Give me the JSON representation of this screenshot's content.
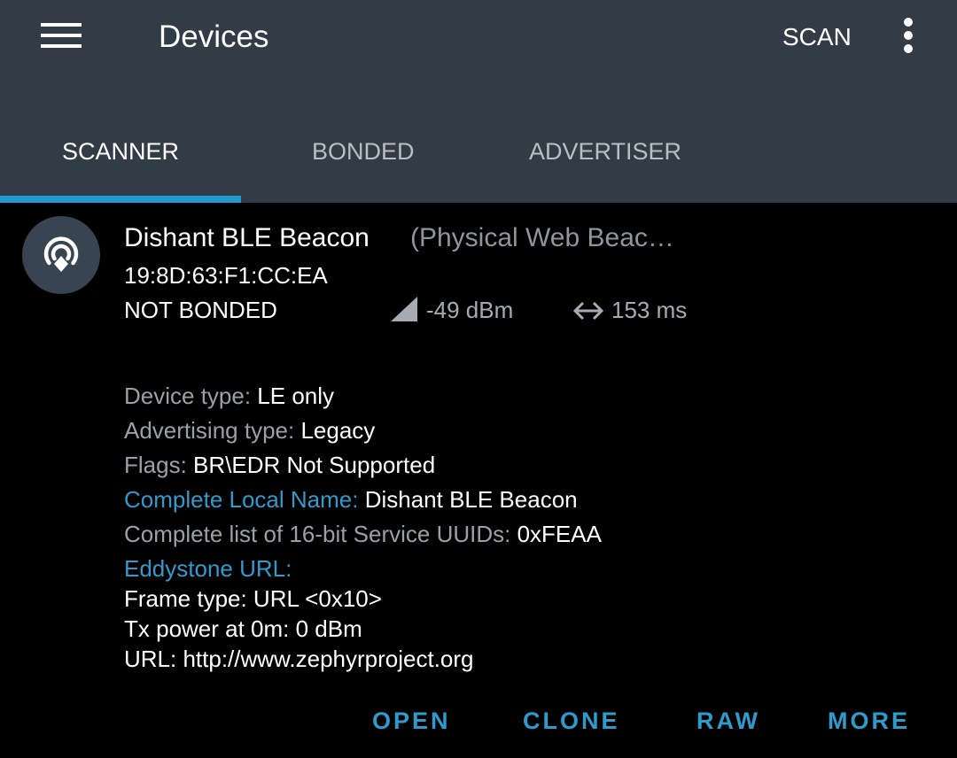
{
  "app_bar": {
    "title": "Devices",
    "scan_label": "SCAN",
    "menu_icon": "hamburger-menu-icon",
    "overflow_icon": "more-vert-icon",
    "background": "#323c46"
  },
  "tabs": [
    {
      "label": "SCANNER",
      "selected": true
    },
    {
      "label": "BONDED",
      "selected": false
    },
    {
      "label": "ADVERTISER",
      "selected": false
    }
  ],
  "accent_color": "#2f9bcc",
  "device": {
    "icon": "eddystone-beacon-icon",
    "name": "Dishant BLE Beacon",
    "type_label": "(Physical Web Beac…",
    "mac": "19:8D:63:F1:CC:EA",
    "bond_state": "NOT BONDED",
    "rssi": "-49 dBm",
    "interval": "153 ms",
    "details": {
      "device_type_label": "Device type: ",
      "device_type_value": "LE only",
      "adv_type_label": "Advertising type: ",
      "adv_type_value": "Legacy",
      "flags_label": "Flags: ",
      "flags_value": "BR\\EDR Not Supported",
      "local_name_label": "Complete Local Name: ",
      "local_name_value": "Dishant BLE Beacon",
      "uuids_label": "Complete list of 16-bit Service UUIDs: ",
      "uuids_value": "0xFEAA",
      "eddystone_label": "Eddystone URL:",
      "frame_type": "Frame type: URL <0x10>",
      "tx_power": "Tx power at 0m: 0 dBm",
      "url": "URL: http://www.zephyrproject.org"
    },
    "actions": {
      "open": "OPEN",
      "clone": "CLONE",
      "raw": "RAW",
      "more": "MORE"
    }
  }
}
